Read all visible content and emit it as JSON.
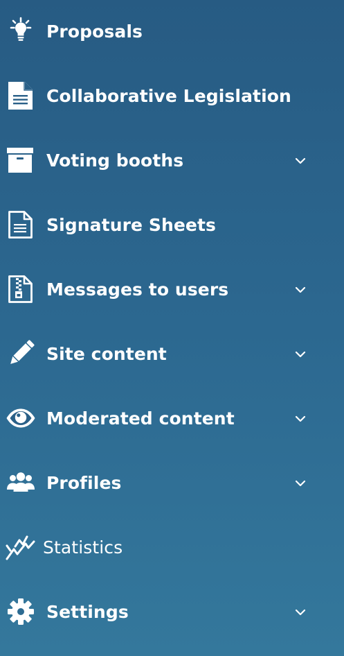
{
  "menu": {
    "items": [
      {
        "label": "Proposals",
        "icon": "lightbulb-icon",
        "has_submenu": false
      },
      {
        "label": "Collaborative Legislation",
        "icon": "document-icon",
        "has_submenu": false
      },
      {
        "label": "Voting booths",
        "icon": "archive-box-icon",
        "has_submenu": true
      },
      {
        "label": "Signature Sheets",
        "icon": "document-outline-icon",
        "has_submenu": false
      },
      {
        "label": "Messages to users",
        "icon": "zip-file-icon",
        "has_submenu": true
      },
      {
        "label": "Site content",
        "icon": "pencil-icon",
        "has_submenu": true
      },
      {
        "label": "Moderated content",
        "icon": "eye-icon",
        "has_submenu": true
      },
      {
        "label": "Profiles",
        "icon": "users-icon",
        "has_submenu": true
      },
      {
        "label": "Statistics",
        "icon": "line-chart-icon",
        "has_submenu": false
      },
      {
        "label": "Settings",
        "icon": "gear-icon",
        "has_submenu": true
      }
    ]
  },
  "colors": {
    "background_top": "#275b83",
    "background_bottom": "#34789c",
    "text": "#ffffff"
  }
}
